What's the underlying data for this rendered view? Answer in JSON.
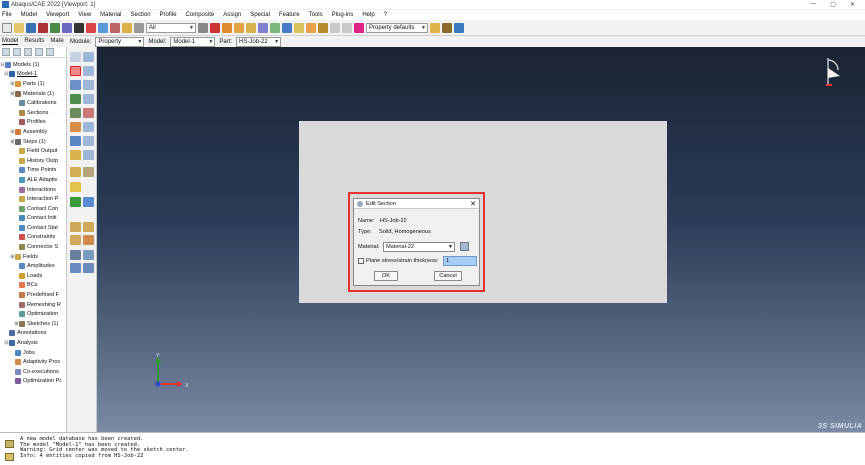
{
  "window": {
    "title": "Abaqus/CAE 2022 [Viewport: 1]",
    "controls": [
      "—",
      "▢",
      "✕"
    ]
  },
  "menu": [
    "File",
    "Model",
    "Viewport",
    "View",
    "Material",
    "Section",
    "Profile",
    "Composite",
    "Assign",
    "Special",
    "Feature",
    "Tools",
    "Plug-ins",
    "Help",
    "?"
  ],
  "toolbar": {
    "selection_filter": "All",
    "render_style": "Property defaults"
  },
  "context": {
    "tabs": [
      "Model",
      "Results",
      "Mate"
    ],
    "module_label": "Module:",
    "module_value": "Property",
    "model_label": "Model:",
    "model_value": "Model-1",
    "part_label": "Part:",
    "part_value": "HS-Job-22"
  },
  "tree": [
    {
      "label": "Models (1)",
      "exp": "⊟"
    },
    {
      "label": "Model-1",
      "exp": "⊟"
    },
    {
      "label": "Parts (1)",
      "exp": "⊞"
    },
    {
      "label": "Materials (1)",
      "exp": "⊞"
    },
    {
      "label": "Calibrations",
      "exp": ""
    },
    {
      "label": "Sections",
      "exp": ""
    },
    {
      "label": "Profiles",
      "exp": ""
    },
    {
      "label": "Assembly",
      "exp": "⊞"
    },
    {
      "label": "Steps (1)",
      "exp": "⊞"
    },
    {
      "label": "Field Output",
      "exp": ""
    },
    {
      "label": "History Outp",
      "exp": ""
    },
    {
      "label": "Time Points",
      "exp": ""
    },
    {
      "label": "ALE Adaptiv",
      "exp": ""
    },
    {
      "label": "Interactions",
      "exp": ""
    },
    {
      "label": "Interaction P",
      "exp": ""
    },
    {
      "label": "Contact Con",
      "exp": ""
    },
    {
      "label": "Contact Initi",
      "exp": ""
    },
    {
      "label": "Contact Stat",
      "exp": ""
    },
    {
      "label": "Constraints",
      "exp": ""
    },
    {
      "label": "Connector S",
      "exp": ""
    },
    {
      "label": "Fields",
      "exp": "⊞"
    },
    {
      "label": "Amplitudes",
      "exp": ""
    },
    {
      "label": "Loads",
      "exp": ""
    },
    {
      "label": "BCs",
      "exp": ""
    },
    {
      "label": "Predefined F",
      "exp": ""
    },
    {
      "label": "Remeshing R",
      "exp": ""
    },
    {
      "label": "Optimization",
      "exp": ""
    },
    {
      "label": "Sketches (1)",
      "exp": "⊞"
    },
    {
      "label": "Annotations",
      "exp": ""
    },
    {
      "label": "Analysis",
      "exp": "⊟"
    },
    {
      "label": "Jobs",
      "exp": ""
    },
    {
      "label": "Adaptivity Proc",
      "exp": ""
    },
    {
      "label": "Co-executions",
      "exp": ""
    },
    {
      "label": "Optimization Pr",
      "exp": ""
    }
  ],
  "dialog": {
    "title": "Edit Section",
    "name_label": "Name:",
    "name_value": "HS-Job-22",
    "type_label": "Type:",
    "type_value": "Solid, Homogeneous",
    "material_label": "Material:",
    "material_value": "Material-22",
    "plane_label": "Plane stress/strain thickness:",
    "plane_checked": false,
    "thickness_value": "1",
    "ok_label": "OK",
    "cancel_label": "Cancel"
  },
  "triad": {
    "x": "X",
    "y": "Y"
  },
  "messages": [
    "A new model database has been created.",
    "The model \"Model-1\" has been created.",
    "Warning: Grid center was moved to the sketch center.",
    "Info: 4 entities copied from HS-Job-22"
  ],
  "brand": "3S SIMULIA"
}
